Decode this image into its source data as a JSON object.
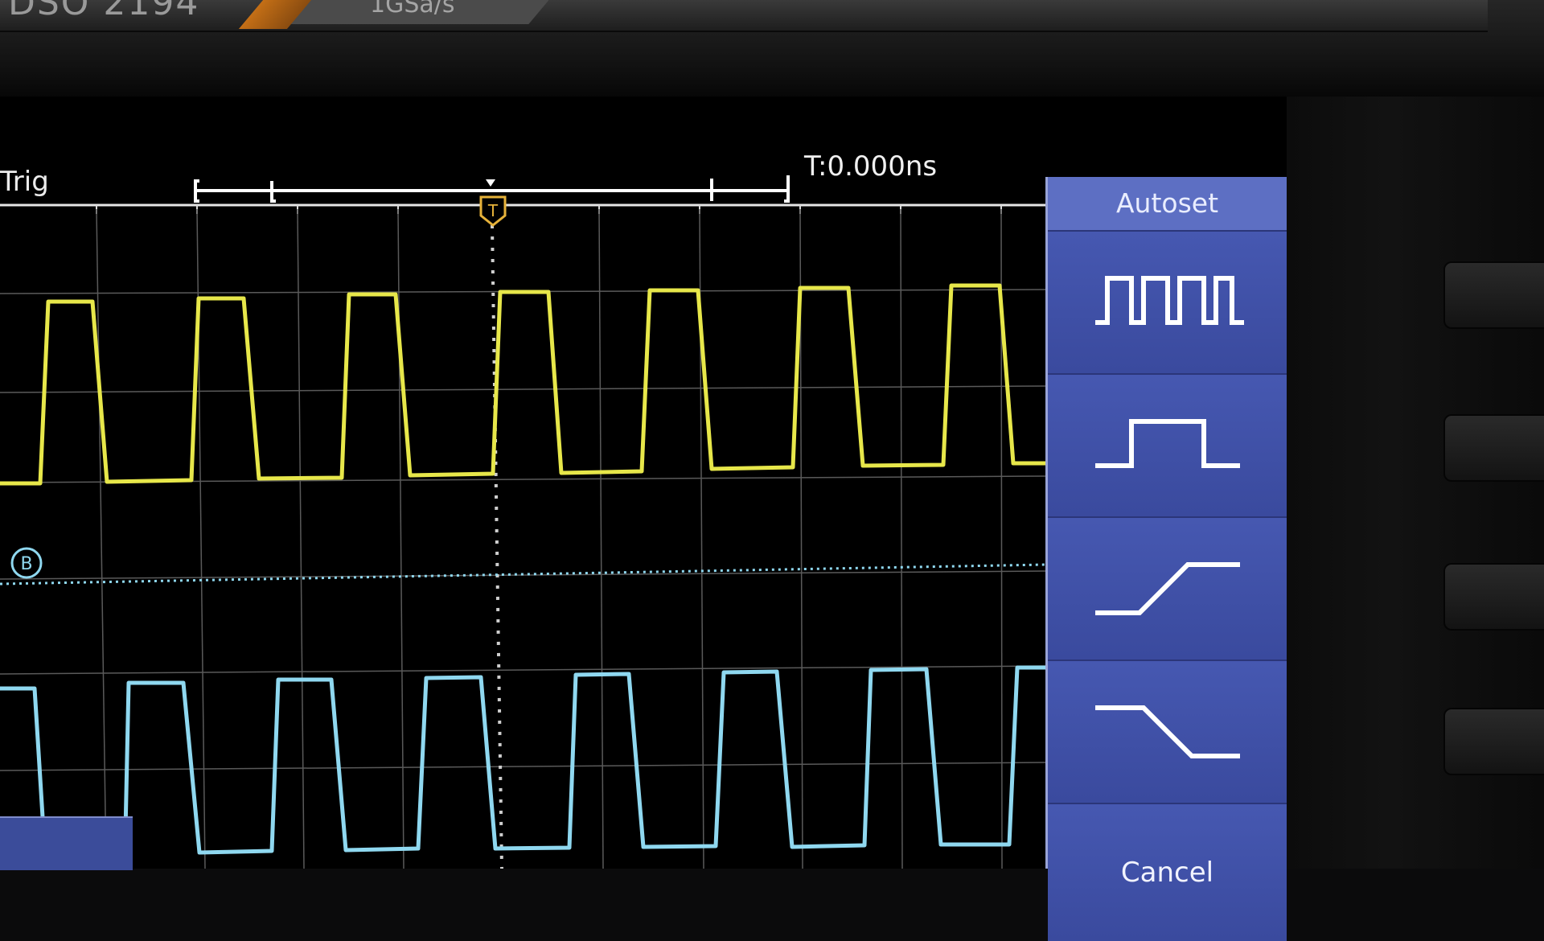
{
  "device": {
    "model": "DSO 2194",
    "sample_rate": "1GSa/s"
  },
  "status": {
    "trigger_label": "Trig",
    "time_offset": "T:0.000ns"
  },
  "channels": {
    "ch1_color": "#e7e74a",
    "ch2_color": "#8fd8f0",
    "ref_marker_label": "B"
  },
  "autoset_menu": {
    "title": "Autoset",
    "options": [
      {
        "icon": "multi-period-square-wave-icon"
      },
      {
        "icon": "single-period-pulse-icon"
      },
      {
        "icon": "rising-edge-icon"
      },
      {
        "icon": "falling-edge-icon"
      }
    ],
    "cancel_label": "Cancel",
    "background_color": "#3d4ea3"
  }
}
